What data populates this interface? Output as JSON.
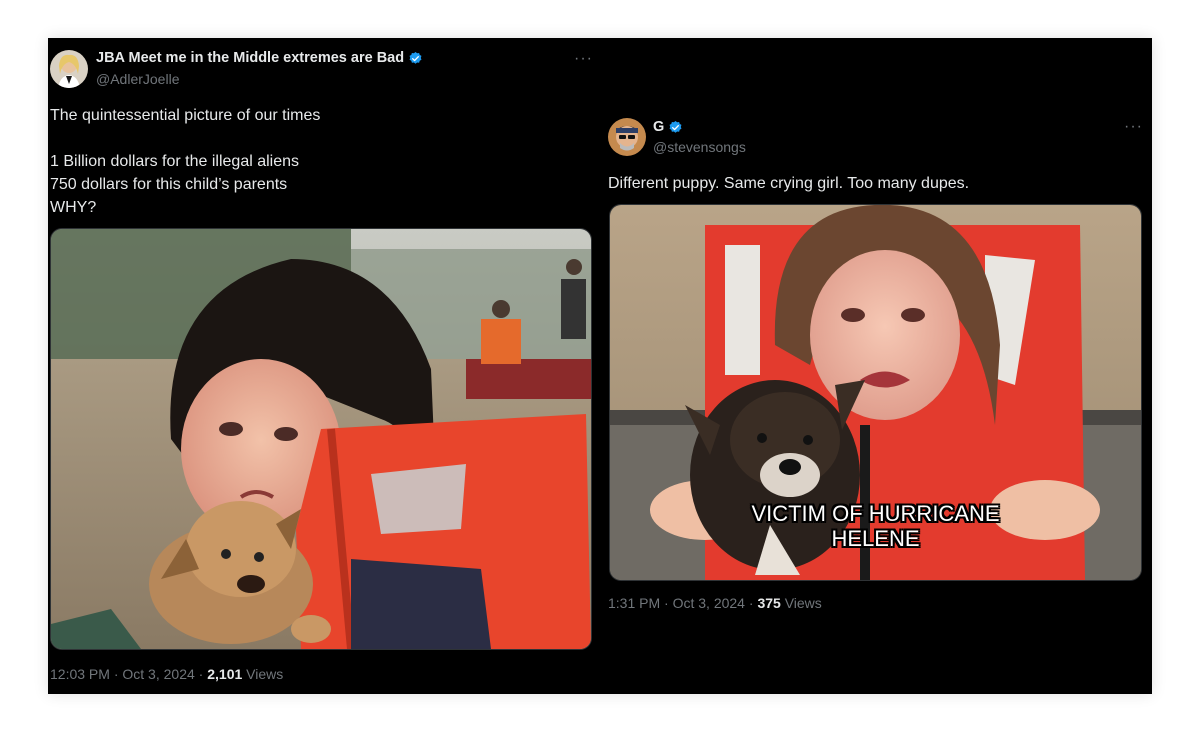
{
  "tweets": [
    {
      "display_name": "JBA Meet me in the Middle extremes are Bad",
      "handle": "@AdlerJoelle",
      "verified": true,
      "more_label": "···",
      "text_lines": [
        "The quintessential picture of our times",
        "",
        "1 Billion dollars for the illegal aliens",
        "750 dollars for this child’s parents",
        "WHY?"
      ],
      "media_description_icon": "photo-crying-girl-with-puppy",
      "time": "12:03 PM",
      "separator": "·",
      "date": "Oct 3, 2024",
      "views_count": "2,101",
      "views_label": "Views"
    },
    {
      "display_name": "G",
      "handle": "@stevensongs",
      "verified": true,
      "more_label": "···",
      "text_lines": [
        "Different puppy. Same crying girl. Too many dupes."
      ],
      "media_caption_line1": "VICTIM OF HURRICANE",
      "media_caption_line2": "HELENE",
      "time": "1:31 PM",
      "separator": "·",
      "date": "Oct 3, 2024",
      "views_count": "375",
      "views_label": "Views"
    }
  ],
  "colors": {
    "background": "#000000",
    "text": "#e7e9ea",
    "muted": "#71767b",
    "verified_blue": "#1d9bf0",
    "life_vest": "#e8452c"
  }
}
